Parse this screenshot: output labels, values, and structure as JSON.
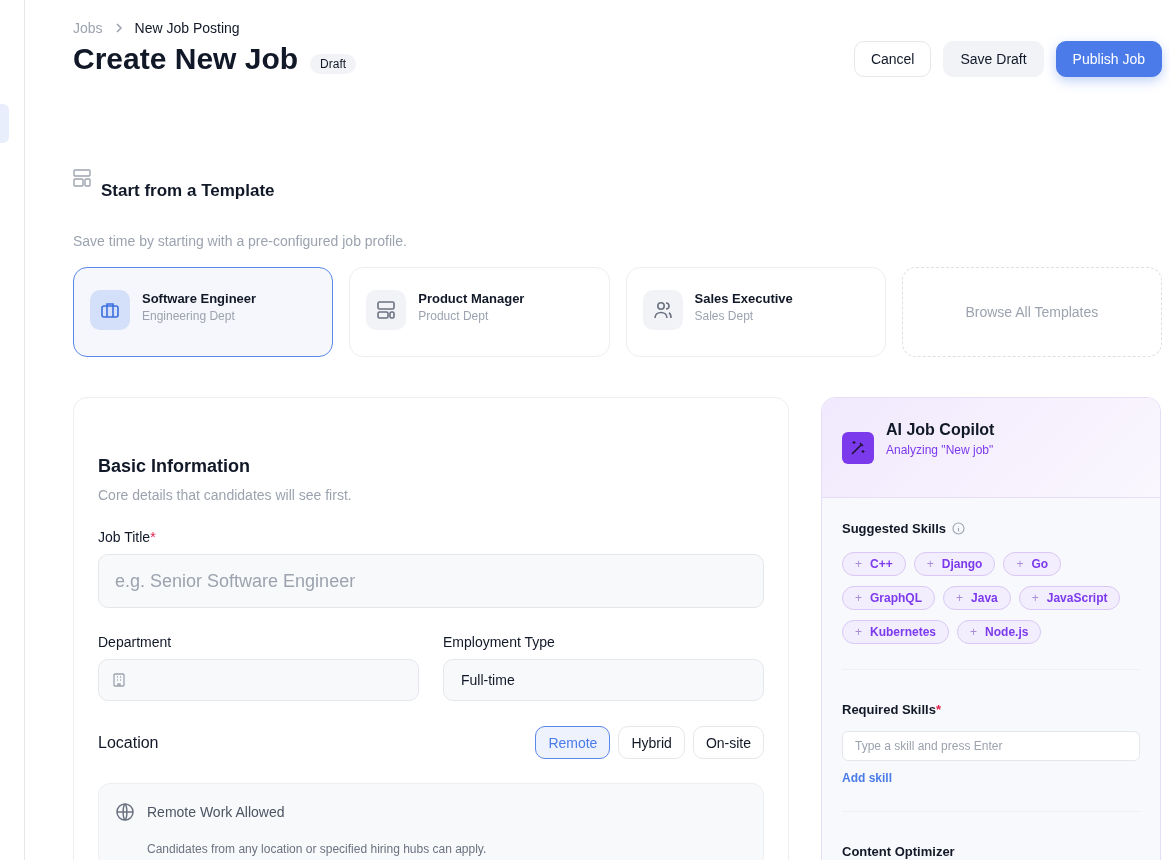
{
  "breadcrumb": [
    {
      "label": "Jobs",
      "current": false
    },
    {
      "label": "New Job Posting",
      "current": true
    }
  ],
  "title": "Create New Job",
  "status_badge": "Draft",
  "actions": [
    {
      "label": "Cancel",
      "kind": "outline"
    },
    {
      "label": "Save Draft",
      "kind": "secondary"
    },
    {
      "label": "Publish Job",
      "kind": "primary"
    }
  ],
  "templates": {
    "title": "Start from a Template",
    "subtitle": "Save time by starting with a pre-configured job profile.",
    "items": [
      {
        "name": "Software Engineer",
        "dept": "Engineering Dept",
        "kind": "briefcase",
        "selected": true
      },
      {
        "name": "Product Manager",
        "dept": "Product Dept",
        "kind": "layout",
        "selected": false
      },
      {
        "name": "Sales Executive",
        "dept": "Sales Dept",
        "kind": "people",
        "selected": false
      }
    ],
    "browse": "Browse All Templates"
  },
  "basic_info": {
    "title": "Basic Information",
    "subtitle": "Core details that candidates will see first.",
    "job_title": {
      "label": "Job Title",
      "required_mark": "*",
      "placeholder": "e.g. Senior Software Engineer"
    },
    "department": {
      "label": "Department"
    },
    "employment_type": {
      "label": "Employment Type",
      "value": "Full-time"
    },
    "location": {
      "label": "Location",
      "options": [
        {
          "label": "Remote",
          "selected": true
        },
        {
          "label": "Hybrid",
          "selected": false
        },
        {
          "label": "On-site",
          "selected": false
        }
      ],
      "note_title": "Remote Work Allowed",
      "note_text": "Candidates from any location or specified hiring hubs can apply."
    }
  },
  "copilot": {
    "title": "AI Job Copilot",
    "subtitle": "Analyzing \"New job\"",
    "suggested_title": "Suggested Skills",
    "skills": [
      {
        "plus": "+",
        "name": "C++"
      },
      {
        "plus": "+",
        "name": "Django"
      },
      {
        "plus": "+",
        "name": "Go"
      },
      {
        "plus": "+",
        "name": "GraphQL"
      },
      {
        "plus": "+",
        "name": "Java"
      },
      {
        "plus": "+",
        "name": "JavaScript"
      },
      {
        "plus": "+",
        "name": "Kubernetes"
      },
      {
        "plus": "+",
        "name": "Node.js"
      }
    ],
    "required": {
      "label": "Required Skills",
      "required_mark": "*",
      "placeholder": "Type a skill and press Enter",
      "link": "Add skill"
    },
    "optimizer_title": "Content Optimizer"
  }
}
